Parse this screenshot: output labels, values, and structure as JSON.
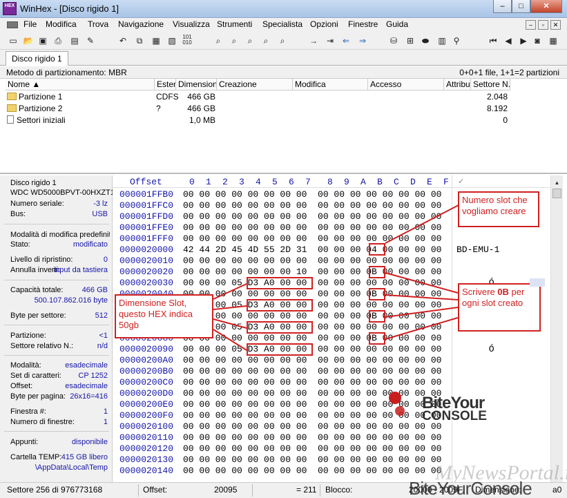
{
  "window": {
    "title": "WinHex - [Disco rigido 1]",
    "logo": "HEX",
    "minimize": "–",
    "maximize": "□",
    "close": "✕",
    "mdi_min": "–",
    "mdi_restore": "▫",
    "mdi_close": "✕"
  },
  "menu": [
    "File",
    "Modifica",
    "Trova",
    "Navigazione",
    "Visualizza",
    "Strumenti",
    "Specialista",
    "Opzioni",
    "Finestre",
    "Guida"
  ],
  "toolbar_icons": [
    "disk-icon",
    "open-folder-icon",
    "save-icon",
    "print-icon",
    "properties-icon",
    "undo-icon",
    "copy-icon",
    "paste-icon",
    "paste-special-icon",
    "binary-icon",
    "find-text-icon",
    "find-hex-icon",
    "replace-text-icon",
    "replace-hex-icon",
    "find-binary-icon",
    "go-offset-icon",
    "go-to-icon",
    "back-icon",
    "forward-icon",
    "disk-tools-icon",
    "partition-icon",
    "drive-icon",
    "ram-icon",
    "calculator-icon",
    "search-icon",
    "first-icon",
    "prev-icon",
    "next-icon",
    "camera-icon",
    "table-icon"
  ],
  "tab": {
    "label": "Disco rigido 1"
  },
  "partition_info": {
    "method": "Metodo di partizionamento: MBR",
    "summary": "0+0+1 file, 1+1=2 partizioni"
  },
  "file_table": {
    "columns": [
      "Nome ▲",
      "Estens",
      "Dimensione",
      "Creazione",
      "Modifica",
      "Accesso",
      "Attributo",
      "Settore N. 1"
    ],
    "rows": [
      {
        "name": "Partizione 1",
        "ext": "CDFS",
        "size": "466 GB",
        "sector": "2.048"
      },
      {
        "name": "Partizione 2",
        "ext": "?",
        "size": "466 GB",
        "sector": "8.192"
      },
      {
        "name": "Settori iniziali",
        "ext": "",
        "size": "1,0 MB",
        "sector": "0"
      }
    ]
  },
  "info": {
    "disk": "Disco rigido 1",
    "model": "WDC WD5000BPVT-00HXZT1",
    "serial_label": "Numero seriale:",
    "serial_value": "-3 lz",
    "bus_label": "Bus:",
    "bus_value": "USB",
    "edit_mode": "Modalità di modifica predefinita",
    "state_label": "Stato:",
    "state_value": "modificato",
    "undo_label": "Livello di ripristino:",
    "undo_value": "0",
    "undo_rev_label": "Annulla inverti:",
    "undo_rev_value": "input da tastiera",
    "cap_label": "Capacità totale:",
    "cap_value": "466 GB",
    "cap_bytes": "500.107.862.016 byte",
    "bps_label": "Byte per settore:",
    "bps_value": "512",
    "part_label": "Partizione:",
    "part_value": "<1",
    "relsec_label": "Settore relativo N.:",
    "relsec_value": "n/d",
    "mode_label": "Modalità:",
    "mode_value": "esadecimale",
    "charset_label": "Set di caratteri:",
    "charset_value": "CP 1252",
    "offset_label": "Offset:",
    "offset_value": "esadecimale",
    "bpp_label": "Byte per pagina:",
    "bpp_value": "26x16=416",
    "win_label": "Finestra #:",
    "win_value": "1",
    "wins_label": "Numero di finestre:",
    "wins_value": "1",
    "clip_label": "Appunti:",
    "clip_value": "disponibile",
    "temp_label": "Cartella TEMP:",
    "temp_value": "415 GB libero",
    "temp_path": "\\AppData\\Local\\Temp"
  },
  "hex": {
    "offset_header": "Offset",
    "column_headers": [
      "0",
      "1",
      "2",
      "3",
      "4",
      "5",
      "6",
      "7",
      "8",
      "9",
      "A",
      "B",
      "C",
      "D",
      "E",
      "F"
    ],
    "rows": [
      {
        "offset": "000001FFB0",
        "bytes": "00 00 00 00 00 00 00 00  00 00 00 00 00 00 00 00",
        "ascii": ""
      },
      {
        "offset": "000001FFC0",
        "bytes": "00 00 00 00 00 00 00 00  00 00 00 00 00 00 00 00",
        "ascii": ""
      },
      {
        "offset": "000001FFD0",
        "bytes": "00 00 00 00 00 00 00 00  00 00 00 00 00 00 00 00",
        "ascii": ""
      },
      {
        "offset": "000001FFE0",
        "bytes": "00 00 00 00 00 00 00 00  00 00 00 00 00 00 00 00",
        "ascii": ""
      },
      {
        "offset": "000001FFF0",
        "bytes": "00 00 00 00 00 00 00 00  00 00 00 00 00 00 00 00",
        "ascii": ""
      },
      {
        "offset": "0000020000",
        "bytes": "42 44 2D 45 4D 55 2D 31  00 00 00 04 00 00 00 00",
        "ascii": "BD-EMU-1"
      },
      {
        "offset": "0000020010",
        "bytes": "00 00 00 00 00 00 00 00  00 00 00 00 00 00 00 00",
        "ascii": ""
      },
      {
        "offset": "0000020020",
        "bytes": "00 00 00 00 00 00 00 10  00 00 00 0B 00 00 00 00",
        "ascii": ""
      },
      {
        "offset": "0000020030",
        "bytes": "00 00 00 05 D3 A0 00 00  00 00 00 00 00 00 00 00",
        "ascii": "      Ó"
      },
      {
        "offset": "0000020040",
        "bytes": "00 00 00 00 00 00 00 00  00 00 00 0B 00 00 00 00",
        "ascii": ""
      },
      {
        "offset": "0000020050",
        "bytes": "00 00 00 05 D3 A0 00 00  00 00 00 00 00 00 00 00",
        "ascii": "      Ó"
      },
      {
        "offset": "0000020060",
        "bytes": "00 00 00 00 00 00 00 00  00 00 00 0B 00 00 00 00",
        "ascii": ""
      },
      {
        "offset": "0000020070",
        "bytes": "00 00 00 05 D3 A0 00 00  00 00 00 00 00 00 00 00",
        "ascii": "      Ó"
      },
      {
        "offset": "0000020080",
        "bytes": "00 00 00 00 00 00 00 00  00 00 00 0B 00 00 00 00",
        "ascii": ""
      },
      {
        "offset": "0000020090",
        "bytes": "00 00 00 05 D3 A0 00 00  00 00 00 00 00 00 00 00",
        "ascii": "      Ó"
      },
      {
        "offset": "00000200A0",
        "bytes": "00 00 00 00 00 00 00 00  00 00 00 00 00 00 00 00",
        "ascii": ""
      },
      {
        "offset": "00000200B0",
        "bytes": "00 00 00 00 00 00 00 00  00 00 00 00 00 00 00 00",
        "ascii": ""
      },
      {
        "offset": "00000200C0",
        "bytes": "00 00 00 00 00 00 00 00  00 00 00 00 00 00 00 00",
        "ascii": ""
      },
      {
        "offset": "00000200D0",
        "bytes": "00 00 00 00 00 00 00 00  00 00 00 00 00 00 00 00",
        "ascii": ""
      },
      {
        "offset": "00000200E0",
        "bytes": "00 00 00 00 00 00 00 00  00 00 00 00 00 00 00 00",
        "ascii": ""
      },
      {
        "offset": "00000200F0",
        "bytes": "00 00 00 00 00 00 00 00  00 00 00 00 00 00 00 00",
        "ascii": ""
      },
      {
        "offset": "0000020100",
        "bytes": "00 00 00 00 00 00 00 00  00 00 00 00 00 00 00 00",
        "ascii": ""
      },
      {
        "offset": "0000020110",
        "bytes": "00 00 00 00 00 00 00 00  00 00 00 00 00 00 00 00",
        "ascii": ""
      },
      {
        "offset": "0000020120",
        "bytes": "00 00 00 00 00 00 00 00  00 00 00 00 00 00 00 00",
        "ascii": ""
      },
      {
        "offset": "0000020130",
        "bytes": "00 00 00 00 00 00 00 00  00 00 00 00 00 00 00 00",
        "ascii": ""
      },
      {
        "offset": "0000020140",
        "bytes": "00 00 00 00 00 00 00 00  00 00 00 00 00 00 00 00",
        "ascii": ""
      }
    ]
  },
  "annotations": {
    "slot_number": "Numero slot che vogliamo creare",
    "write_0b_pre": "Scrivere ",
    "write_0b_bold": "0B",
    "write_0b_post": " per ogni slot creato",
    "slot_size": "Dimensione Slot, questo HEX indica 50gb",
    "color": "#d02020"
  },
  "watermarks": {
    "brand_line1": "BiteYour",
    "brand_line2": "CONSOLE",
    "portal": "MyNewsPortal.iT",
    "bottom": "BiteYourConsole"
  },
  "status": {
    "sector": "Settore 256 di 976773168",
    "offset_label": "Offset:",
    "offset_value": "20095",
    "value": "= 211",
    "block_label": "Blocco:",
    "block_value": "20000 - 2009F",
    "size_label": "Dimensione:",
    "size_value": "a0"
  }
}
